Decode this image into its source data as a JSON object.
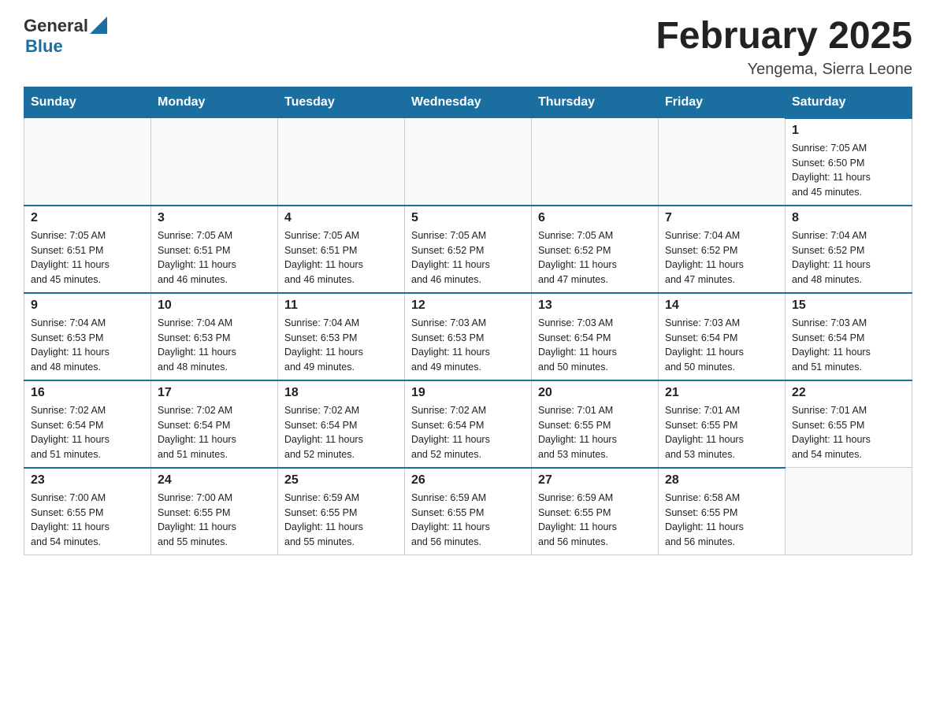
{
  "header": {
    "logo_general": "General",
    "logo_blue": "Blue",
    "title": "February 2025",
    "subtitle": "Yengema, Sierra Leone"
  },
  "days_of_week": [
    "Sunday",
    "Monday",
    "Tuesday",
    "Wednesday",
    "Thursday",
    "Friday",
    "Saturday"
  ],
  "weeks": [
    [
      {
        "day": "",
        "info": ""
      },
      {
        "day": "",
        "info": ""
      },
      {
        "day": "",
        "info": ""
      },
      {
        "day": "",
        "info": ""
      },
      {
        "day": "",
        "info": ""
      },
      {
        "day": "",
        "info": ""
      },
      {
        "day": "1",
        "info": "Sunrise: 7:05 AM\nSunset: 6:50 PM\nDaylight: 11 hours\nand 45 minutes."
      }
    ],
    [
      {
        "day": "2",
        "info": "Sunrise: 7:05 AM\nSunset: 6:51 PM\nDaylight: 11 hours\nand 45 minutes."
      },
      {
        "day": "3",
        "info": "Sunrise: 7:05 AM\nSunset: 6:51 PM\nDaylight: 11 hours\nand 46 minutes."
      },
      {
        "day": "4",
        "info": "Sunrise: 7:05 AM\nSunset: 6:51 PM\nDaylight: 11 hours\nand 46 minutes."
      },
      {
        "day": "5",
        "info": "Sunrise: 7:05 AM\nSunset: 6:52 PM\nDaylight: 11 hours\nand 46 minutes."
      },
      {
        "day": "6",
        "info": "Sunrise: 7:05 AM\nSunset: 6:52 PM\nDaylight: 11 hours\nand 47 minutes."
      },
      {
        "day": "7",
        "info": "Sunrise: 7:04 AM\nSunset: 6:52 PM\nDaylight: 11 hours\nand 47 minutes."
      },
      {
        "day": "8",
        "info": "Sunrise: 7:04 AM\nSunset: 6:52 PM\nDaylight: 11 hours\nand 48 minutes."
      }
    ],
    [
      {
        "day": "9",
        "info": "Sunrise: 7:04 AM\nSunset: 6:53 PM\nDaylight: 11 hours\nand 48 minutes."
      },
      {
        "day": "10",
        "info": "Sunrise: 7:04 AM\nSunset: 6:53 PM\nDaylight: 11 hours\nand 48 minutes."
      },
      {
        "day": "11",
        "info": "Sunrise: 7:04 AM\nSunset: 6:53 PM\nDaylight: 11 hours\nand 49 minutes."
      },
      {
        "day": "12",
        "info": "Sunrise: 7:03 AM\nSunset: 6:53 PM\nDaylight: 11 hours\nand 49 minutes."
      },
      {
        "day": "13",
        "info": "Sunrise: 7:03 AM\nSunset: 6:54 PM\nDaylight: 11 hours\nand 50 minutes."
      },
      {
        "day": "14",
        "info": "Sunrise: 7:03 AM\nSunset: 6:54 PM\nDaylight: 11 hours\nand 50 minutes."
      },
      {
        "day": "15",
        "info": "Sunrise: 7:03 AM\nSunset: 6:54 PM\nDaylight: 11 hours\nand 51 minutes."
      }
    ],
    [
      {
        "day": "16",
        "info": "Sunrise: 7:02 AM\nSunset: 6:54 PM\nDaylight: 11 hours\nand 51 minutes."
      },
      {
        "day": "17",
        "info": "Sunrise: 7:02 AM\nSunset: 6:54 PM\nDaylight: 11 hours\nand 51 minutes."
      },
      {
        "day": "18",
        "info": "Sunrise: 7:02 AM\nSunset: 6:54 PM\nDaylight: 11 hours\nand 52 minutes."
      },
      {
        "day": "19",
        "info": "Sunrise: 7:02 AM\nSunset: 6:54 PM\nDaylight: 11 hours\nand 52 minutes."
      },
      {
        "day": "20",
        "info": "Sunrise: 7:01 AM\nSunset: 6:55 PM\nDaylight: 11 hours\nand 53 minutes."
      },
      {
        "day": "21",
        "info": "Sunrise: 7:01 AM\nSunset: 6:55 PM\nDaylight: 11 hours\nand 53 minutes."
      },
      {
        "day": "22",
        "info": "Sunrise: 7:01 AM\nSunset: 6:55 PM\nDaylight: 11 hours\nand 54 minutes."
      }
    ],
    [
      {
        "day": "23",
        "info": "Sunrise: 7:00 AM\nSunset: 6:55 PM\nDaylight: 11 hours\nand 54 minutes."
      },
      {
        "day": "24",
        "info": "Sunrise: 7:00 AM\nSunset: 6:55 PM\nDaylight: 11 hours\nand 55 minutes."
      },
      {
        "day": "25",
        "info": "Sunrise: 6:59 AM\nSunset: 6:55 PM\nDaylight: 11 hours\nand 55 minutes."
      },
      {
        "day": "26",
        "info": "Sunrise: 6:59 AM\nSunset: 6:55 PM\nDaylight: 11 hours\nand 56 minutes."
      },
      {
        "day": "27",
        "info": "Sunrise: 6:59 AM\nSunset: 6:55 PM\nDaylight: 11 hours\nand 56 minutes."
      },
      {
        "day": "28",
        "info": "Sunrise: 6:58 AM\nSunset: 6:55 PM\nDaylight: 11 hours\nand 56 minutes."
      },
      {
        "day": "",
        "info": ""
      }
    ]
  ]
}
